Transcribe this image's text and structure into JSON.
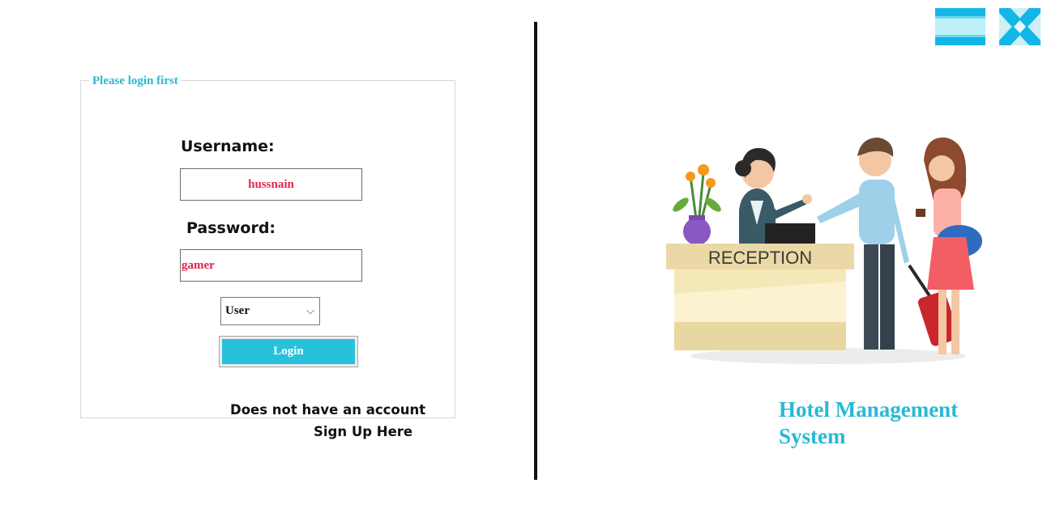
{
  "login": {
    "group_title": "Please login first",
    "username_label": "Username:",
    "username_value": "hussnain",
    "password_label": "Password:",
    "password_value": "gamer",
    "role_selected": "User",
    "login_button": "Login",
    "no_account_text": "Does not have an account",
    "signup_link": "Sign Up Here"
  },
  "window": {
    "minimize_icon": "minimize-icon",
    "close_icon": "close-icon"
  },
  "hero": {
    "sign_text": "RECEPTION"
  },
  "app": {
    "title_line1": "Hotel Management",
    "title_line2": "System"
  },
  "colors": {
    "accent": "#27c2d9",
    "input_text": "#e0244a",
    "divider": "#111111"
  }
}
